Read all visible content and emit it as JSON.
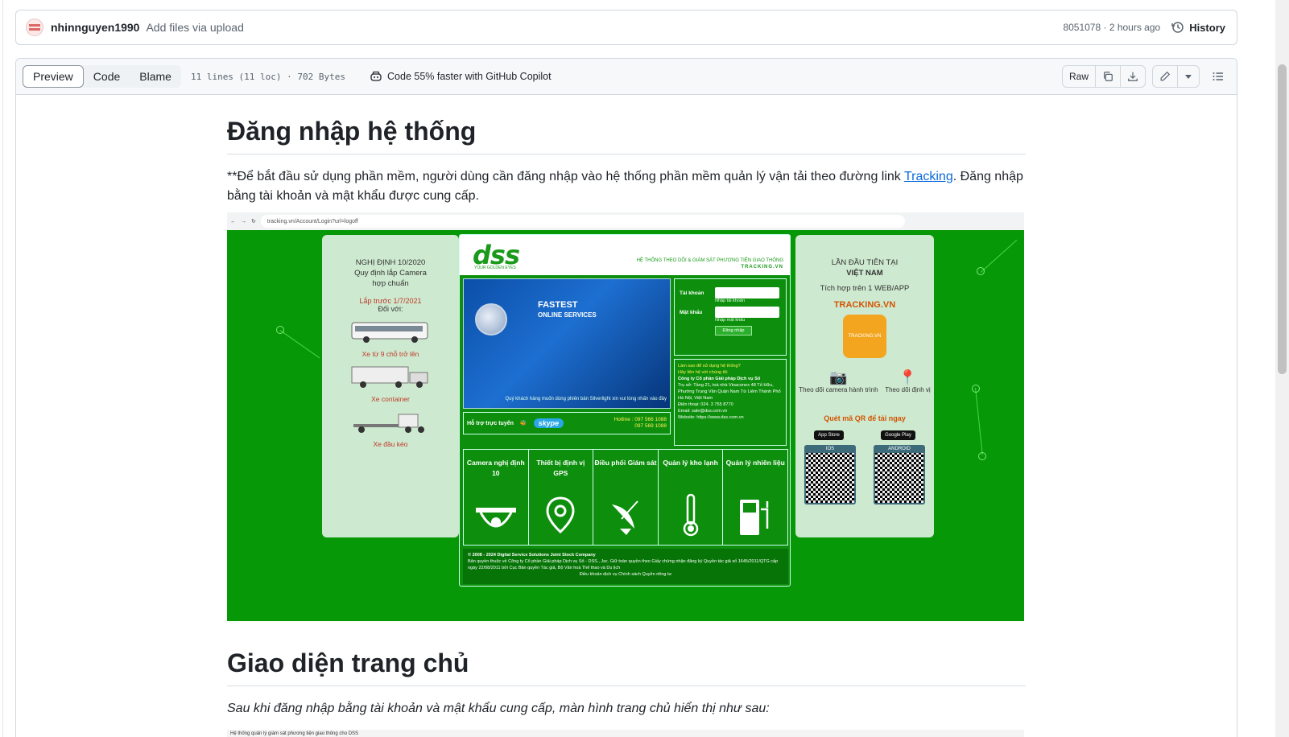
{
  "commit": {
    "user": "nhinnguyen1990",
    "message": "Add files via upload",
    "meta": "8051078 · 2 hours ago",
    "history_label": "History"
  },
  "file_header": {
    "tabs": [
      "Preview",
      "Code",
      "Blame"
    ],
    "info": "11 lines (11 loc) · 702 Bytes",
    "copilot": "Code 55% faster with GitHub Copilot",
    "raw_label": "Raw"
  },
  "markdown": {
    "h1_login": "Đăng nhập hệ thống",
    "login_text_before": "**Để bắt đầu sử dụng phần mềm, người dùng cần đăng nhập vào hệ thống phần mềm quản lý vận tải theo đường link ",
    "login_link": "Tracking",
    "login_text_after": ". Đăng nhập bằng tài khoản và mật khẩu được cung cấp.",
    "h1_home": "Giao diện trang chủ",
    "home_text": "Sau khi đăng nhập bằng tài khoản và mật khẩu cung cấp, màn hình trang chủ hiển thị như sau:"
  },
  "screenshot": {
    "url": "tracking.vn/Account/Login?url=logoff",
    "left_panel": {
      "title": "NGHỊ ĐỊNH 10/2020\nQuy định lắp Camera\nhợp chuẩn",
      "deadline": "Lắp trước 1/7/2021",
      "for": "Đối với:",
      "vehicles": [
        "Xe từ 9 chỗ trở lên",
        "Xe container",
        "Xe đầu kéo"
      ]
    },
    "logo": "dss",
    "logo_sub": "YOUR GOLDEN EYES",
    "tagline": "HỆ THỐNG THEO DÕI & GIÁM SÁT PHƯƠNG TIỆN GIAO THÔNG",
    "tagline_brand": "TRACKING.VN",
    "banner_title": "FASTEST",
    "banner_sub": "ONLINE SERVICES",
    "banner_note": "Quý khách hàng muốn dùng phiên bản Silverlight xin vui lòng nhấn vào đây",
    "login": {
      "user_label": "Tài khoản",
      "user_hint": "Nhập tài khoản",
      "pass_label": "Mật khẩu",
      "pass_hint": "Nhập mật khẩu",
      "button": "Đăng nhập"
    },
    "info": {
      "q1": "Làm sao để sử dụng hệ thống?",
      "q2": "Hãy liên hệ với chúng tôi",
      "company": "Công ty Cổ phần Giải pháp Dịch vụ Số",
      "address": "Trụ sở: Tầng 21, toà nhà Vinaconex 48 Tố Hữu, Phường Trung Văn Quận Nam Từ Liêm Thành Phố Hà Nội, Việt Nam",
      "phone": "Điện thoại: 024. 3 755 8770",
      "email": "Email: sale@dss.com.vn",
      "website": "Website: https://www.dss.com.vn"
    },
    "support": {
      "label": "Hỗ trợ trực tuyến",
      "skype": "skype",
      "hotline": "Hotline : 097 566 1088\n097 569 1088"
    },
    "features": [
      "Camera nghị định 10",
      "Thiết bị định vị GPS",
      "Điều phối Giám sát",
      "Quản lý kho lạnh",
      "Quản lý nhiên liệu"
    ],
    "footer": {
      "copyright": "© 2008 - 2024 Digital Service Solutions Joint Stock Company",
      "rights": "Bản quyền thuộc về Công ty Cổ phần Giải pháp Dịch vụ Số - DSS., Jsc. Giữ toàn quyền theo Giấy chứng nhận đăng ký Quyền tác giả số 1645/2011/QTG cấp ngày 22/08/2011 bởi Cục Bản quyền Tác giả, Bộ Văn hoá Thể thao và Du lịch",
      "links": "Điều khoản dịch vụ   Chính sách Quyền riêng tư"
    },
    "right_panel": {
      "title1": "LẦN ĐẦU TIÊN TẠI",
      "title2": "VIỆT NAM",
      "title3": "Tích hợp trên 1 WEB/APP",
      "brand": "TRACKING.VN",
      "app_label": "TRACKING.VN",
      "camera": "Theo dõi camera hành trình",
      "location": "Theo dõi định vị",
      "qr": "Quét mã QR để tải ngay",
      "app_store": "App Store",
      "google_play": "Google Play",
      "ios": "IOS",
      "android": "ANDROID"
    },
    "second_caption": "Hệ thống quản lý giám sát phương tiện giao thông cho DSS"
  }
}
